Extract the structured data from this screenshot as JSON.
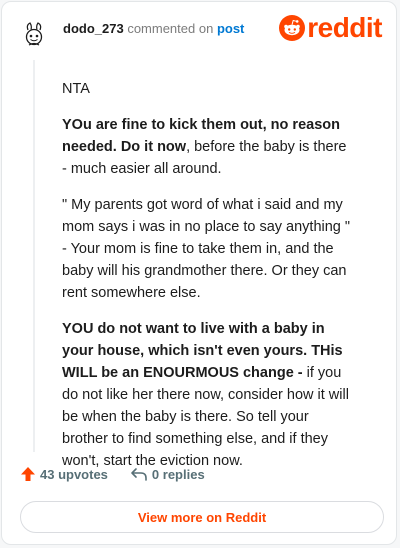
{
  "header": {
    "username": "dodo_273",
    "commented_on": "commented on",
    "post_link": "post",
    "brand": "reddit"
  },
  "comment": {
    "p1": "NTA",
    "p2_bold": "YOu are fine to kick them out, no reason needed. Do it now",
    "p2_rest": ", before the baby is there - much easier all around.",
    "p3": "\" My parents got word of what i said and my mom says i was in no place to say anything \" - Your mom is fine to take them in, and the baby will his grandmother there. Or they can rent somewhere else.",
    "p4_bold": "YOU do not want to live with a baby in your house, which isn't even yours. THis WILL be an ENOURMOUS change -",
    "p4_rest": " if you do not like her there now, consider how it will be when the baby is there. So tell your brother to find something else, and if they won't, start the eviction now."
  },
  "actions": {
    "upvotes": "43 upvotes",
    "replies": "0 replies"
  },
  "view_more": "View more on Reddit",
  "colors": {
    "brand": "#ff4500",
    "link": "#0079d3",
    "muted": "#576f76"
  },
  "icons": {
    "avatar": "snoo-avatar-icon",
    "brand": "reddit-logo-icon",
    "upvote": "upvote-arrow-icon",
    "reply": "reply-arrow-icon"
  }
}
